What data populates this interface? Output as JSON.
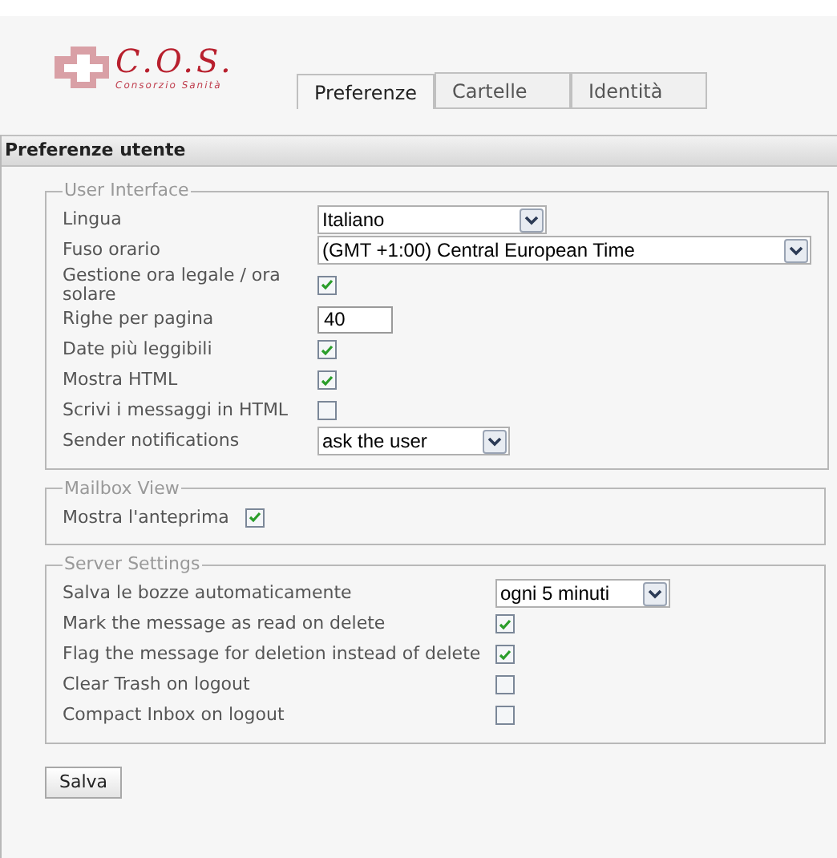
{
  "logo": {
    "title": "C.O.S.",
    "subtitle": "Consorzio Sanità"
  },
  "tabs": [
    {
      "label": "Preferenze",
      "selected": true
    },
    {
      "label": "Cartelle",
      "selected": false
    },
    {
      "label": "Identità",
      "selected": false
    }
  ],
  "panel": {
    "title": "Preferenze utente"
  },
  "sections": [
    {
      "legend": "User Interface",
      "rows": [
        {
          "kind": "select",
          "label": "Lingua",
          "value": "Italiano"
        },
        {
          "kind": "select",
          "label": "Fuso orario",
          "value": "(GMT +1:00) Central European Time"
        },
        {
          "kind": "checkbox",
          "label": "Gestione ora legale / ora solare",
          "checked": true
        },
        {
          "kind": "text",
          "label": "Righe per pagina",
          "value": "40"
        },
        {
          "kind": "checkbox",
          "label": "Date più leggibili",
          "checked": true
        },
        {
          "kind": "checkbox",
          "label": "Mostra HTML",
          "checked": true
        },
        {
          "kind": "checkbox",
          "label": "Scrivi i messaggi in HTML",
          "checked": false
        },
        {
          "kind": "select",
          "label": "Sender notifications",
          "value": "ask the user"
        }
      ]
    },
    {
      "legend": "Mailbox View",
      "rows": [
        {
          "kind": "checkbox",
          "label": "Mostra l'anteprima",
          "checked": true
        }
      ]
    },
    {
      "legend": "Server Settings",
      "rows": [
        {
          "kind": "select",
          "label": "Salva le bozze automaticamente",
          "value": "ogni 5 minuti"
        },
        {
          "kind": "checkbox",
          "label": "Mark the message as read on delete",
          "checked": true
        },
        {
          "kind": "checkbox",
          "label": "Flag the message for deletion instead of delete",
          "checked": true
        },
        {
          "kind": "checkbox",
          "label": "Clear Trash on logout",
          "checked": false
        },
        {
          "kind": "checkbox",
          "label": "Compact Inbox on logout",
          "checked": false
        }
      ]
    }
  ],
  "save_button": "Salva"
}
